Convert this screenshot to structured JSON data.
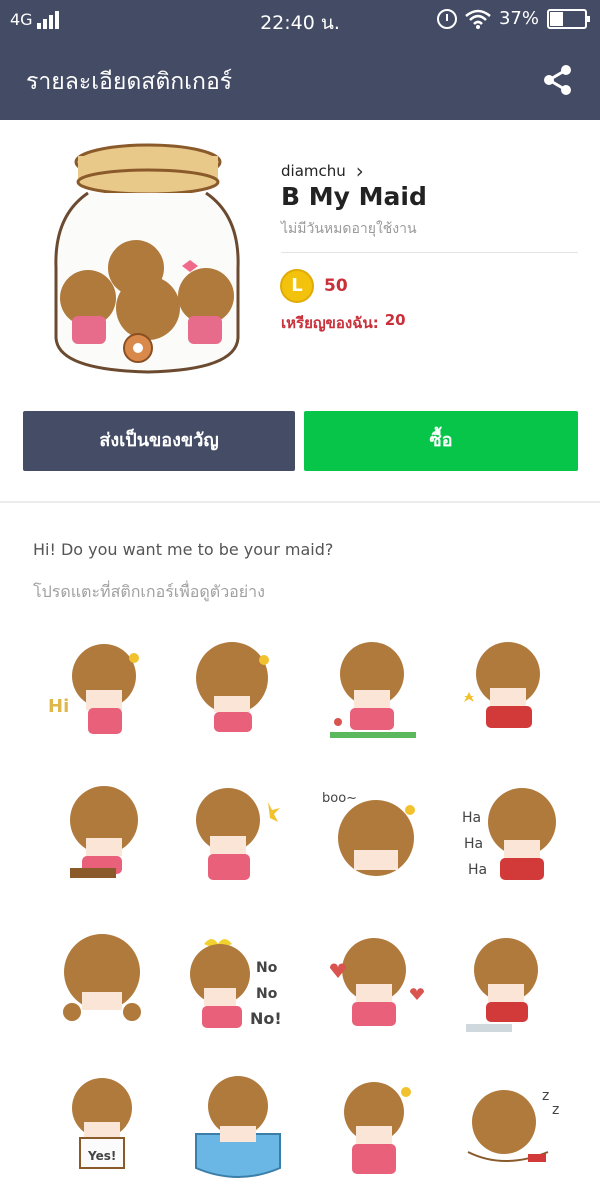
{
  "status_bar": {
    "network": "4G",
    "time": "22:40 น.",
    "battery": "37%",
    "battery_level": 0.37
  },
  "header": {
    "title": "รายละเอียดสติกเกอร์",
    "share_icon": "share-icon"
  },
  "product": {
    "author": "diamchu",
    "title": "B My Maid",
    "validity": "ไม่มีวันหมดอายุใช้งาน",
    "coin_letter": "L",
    "price": "50",
    "my_coins_label": "เหรียญของฉัน:",
    "my_coins_value": "20"
  },
  "actions": {
    "gift_label": "ส่งเป็นของขวัญ",
    "buy_label": "ซื้อ"
  },
  "description": "Hi! Do you want me to be your maid?",
  "hint": "โปรดแตะที่สติกเกอร์เพื่อดูตัวอย่าง",
  "sticker_texts": {
    "s1": "Hi",
    "s8": [
      "Ha",
      "Ha",
      "Ha"
    ],
    "s6": [
      "No",
      "No",
      "No!"
    ],
    "s13": "Yes!",
    "s5": "boo~"
  },
  "colors": {
    "header_bg": "#444c65",
    "buy_green": "#06c548",
    "price_red": "#c9303a",
    "coin_gold": "#f3c20d"
  }
}
